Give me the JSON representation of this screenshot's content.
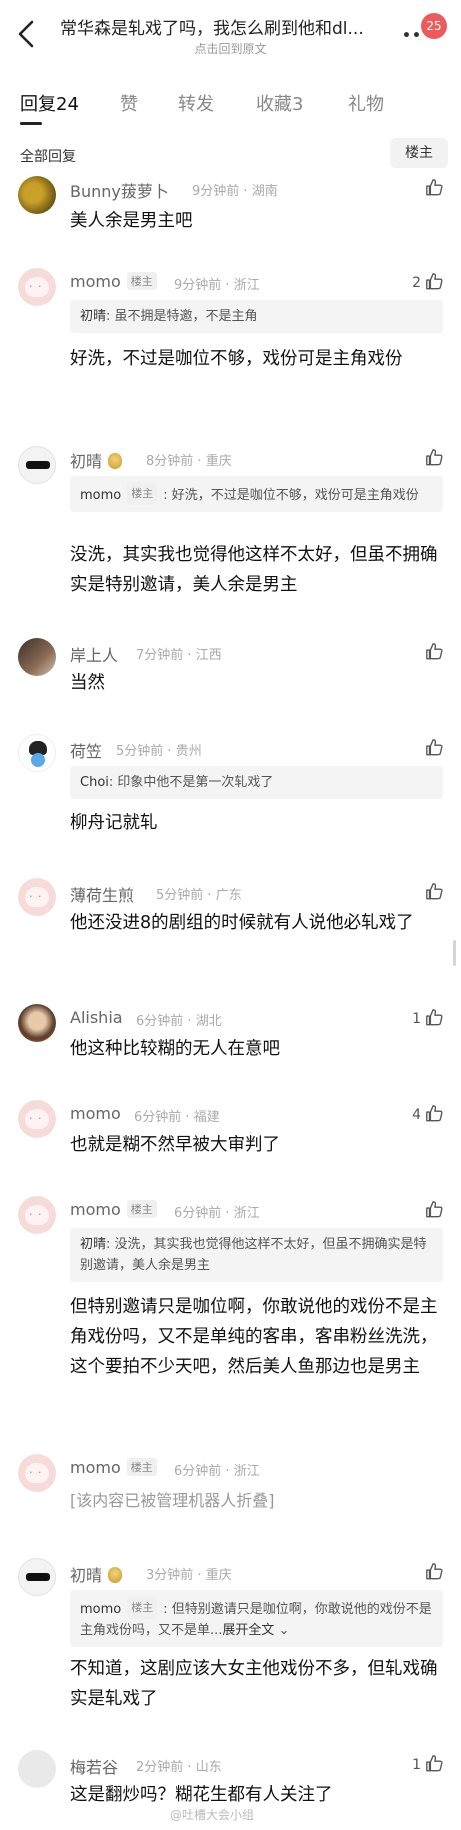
{
  "header": {
    "title": "常华森是轧戏了吗，我怎么刷到他和dl...",
    "subtitle": "点击回到原文",
    "notification_count": "25"
  },
  "tabs": [
    {
      "label": "回复",
      "count": "24",
      "active": true
    },
    {
      "label": "赞",
      "count": "",
      "active": false
    },
    {
      "label": "转发",
      "count": "",
      "active": false
    },
    {
      "label": "收藏",
      "count": "3",
      "active": false
    },
    {
      "label": "礼物",
      "count": "",
      "active": false
    }
  ],
  "section": {
    "title": "全部回复",
    "filter_button": "楼主"
  },
  "comments": [
    {
      "name": "Bunny菝萝卜",
      "is_host": false,
      "time": "9分钟前",
      "location": "湖南",
      "likes": "",
      "quote_name": "",
      "quote": "",
      "text": "美人余是男主吧",
      "avatar": "photo-gold"
    },
    {
      "name": "momo",
      "is_host": true,
      "host_tag": "楼主",
      "time": "9分钟前",
      "location": "浙江",
      "likes": "2",
      "quote_name": "初晴",
      "quote": ": 虽不拥是特邀，不是主角",
      "text": "好洗，不过是咖位不够，戏份可是主角戏份",
      "avatar": "pink"
    },
    {
      "name": "初晴",
      "is_host": false,
      "time": "8分钟前",
      "location": "重庆",
      "likes": "",
      "quote_name": "momo",
      "quote_tag": "楼主",
      "quote": ": 好洗，不过是咖位不够，戏份可是主角戏份",
      "text": "没洗，其实我也觉得他这样不太好，但虽不拥确实是特别邀请，美人余是男主",
      "avatar": "glasses"
    },
    {
      "name": "岸上人",
      "is_host": false,
      "time": "7分钟前",
      "location": "江西",
      "likes": "",
      "quote_name": "",
      "quote": "",
      "text": "当然",
      "avatar": "photo-dark"
    },
    {
      "name": "荷笠",
      "is_host": false,
      "time": "5分钟前",
      "location": "贵州",
      "likes": "",
      "quote_name": "Choi",
      "quote": ": 印象中他不是第一次轧戏了",
      "text": "柳舟记就轧",
      "avatar": "kid"
    },
    {
      "name": "薄荷生煎",
      "is_host": false,
      "time": "5分钟前",
      "location": "广东",
      "likes": "",
      "quote_name": "",
      "quote": "",
      "text": "他还没进8的剧组的时候就有人说他必轧戏了",
      "avatar": "pink"
    },
    {
      "name": "Alishia",
      "is_host": false,
      "time": "6分钟前",
      "location": "湖北",
      "likes": "1",
      "quote_name": "",
      "quote": "",
      "text": "他这种比较糊的无人在意吧",
      "avatar": "photo-face"
    },
    {
      "name": "momo",
      "is_host": false,
      "time": "6分钟前",
      "location": "福建",
      "likes": "4",
      "quote_name": "",
      "quote": "",
      "text": "也就是糊不然早被大审判了",
      "avatar": "pink"
    },
    {
      "name": "momo",
      "is_host": true,
      "host_tag": "楼主",
      "time": "6分钟前",
      "location": "浙江",
      "likes": "",
      "quote_name": "初晴",
      "quote": ": 没洗，其实我也觉得他这样不太好，但虽不拥确实是特别邀请，美人余是男主",
      "text": "但特别邀请只是咖位啊，你敢说他的戏份不是主角戏份吗，又不是单纯的客串，客串粉丝洗洗，这个要拍不少天吧，然后美人鱼那边也是男主",
      "avatar": "pink"
    },
    {
      "name": "momo",
      "is_host": true,
      "host_tag": "楼主",
      "time": "6分钟前",
      "location": "浙江",
      "likes": "",
      "quote_name": "",
      "quote": "",
      "text": "[该内容已被管理机器人折叠]",
      "avatar": "pink"
    },
    {
      "name": "初晴",
      "is_host": false,
      "time": "3分钟前",
      "location": "重庆",
      "likes": "",
      "quote_name": "momo",
      "quote_tag": "楼主",
      "quote": ": 但特别邀请只是咖位啊，你敢说他的戏份不是主角戏份吗，又不是单...",
      "quote_expand": "展开全文",
      "text": "不知道，这剧应该大女主他戏份不多，但轧戏确实是轧戏了",
      "avatar": "glasses"
    },
    {
      "name": "梅若谷",
      "is_host": false,
      "time": "2分钟前",
      "location": "山东",
      "likes": "1",
      "quote_name": "",
      "quote": "",
      "text": "这是翻炒吗？糊花生都有人关注了",
      "avatar": "grey"
    }
  ],
  "watermark": "@吐槽大会小组",
  "icons": {
    "back": "chevron-left-icon",
    "more": "more-dots-icon",
    "like": "thumb-up-icon"
  }
}
